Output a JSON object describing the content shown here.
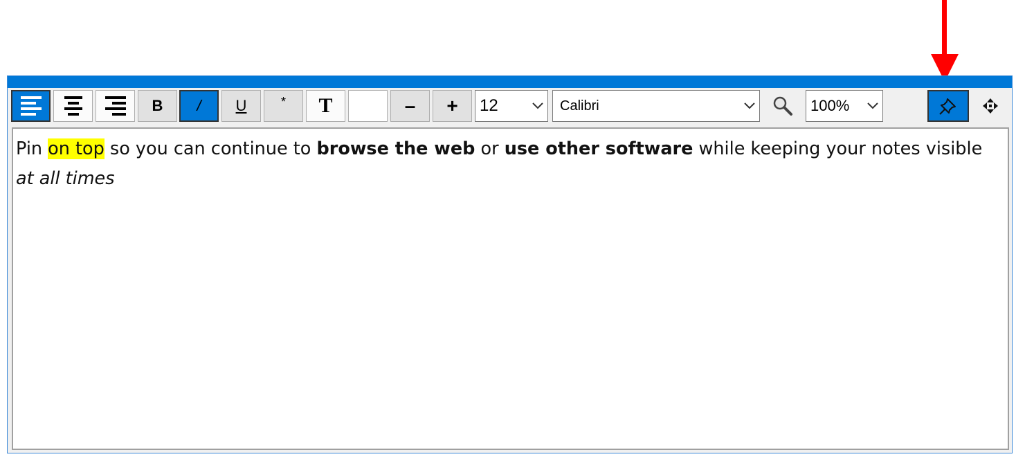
{
  "toolbar": {
    "bold_label": "B",
    "italic_label": "/",
    "underline_label": "U",
    "superscript_label": "*",
    "text_style_label": "T",
    "decrease_label": "–",
    "increase_label": "+",
    "font_size": "12",
    "font_name": "Calibri",
    "zoom": "100%",
    "active": [
      "align-left",
      "italic",
      "pin-on-top"
    ],
    "icons": [
      "align-left-icon",
      "align-center-icon",
      "align-right-icon",
      "search-icon",
      "pin-icon",
      "move-icon",
      "chevron-down-icon"
    ]
  },
  "note": {
    "seg1": "Pin ",
    "seg2": "on top",
    "seg3": " so you can continue to ",
    "seg4": "browse the web",
    "seg5": " or ",
    "seg6": "use other software",
    "seg7": " while keeping your notes visible ",
    "seg8": "at all times"
  },
  "colors": {
    "titlebar": "#0078d7",
    "active_button": "#0078d7",
    "highlight": "#ffff00",
    "annotation_arrow": "#ff0000"
  }
}
